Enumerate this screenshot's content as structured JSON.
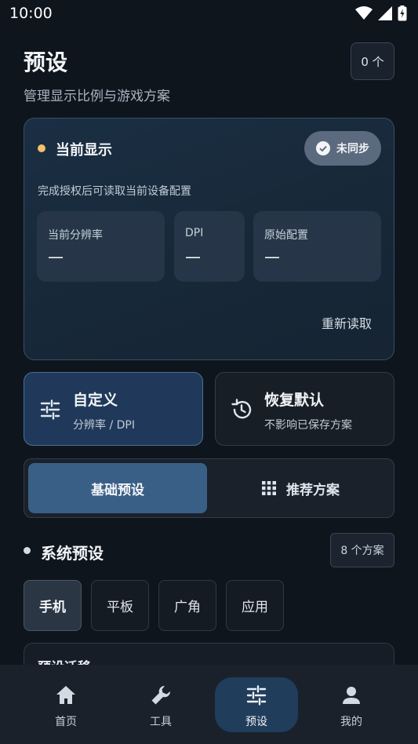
{
  "status_bar": {
    "time": "10:00"
  },
  "header": {
    "title": "预设",
    "subtitle": "管理显示比例与游戏方案",
    "count_badge": "0 个"
  },
  "display_card": {
    "title": "当前显示",
    "sync_status": "未同步",
    "description": "完成授权后可读取当前设备配置",
    "stats": [
      {
        "label": "当前分辨率",
        "value": "—"
      },
      {
        "label": "DPI",
        "value": "—"
      },
      {
        "label": "原始配置",
        "value": "—"
      }
    ],
    "reload_label": "重新读取"
  },
  "actions": {
    "custom": {
      "title": "自定义",
      "subtitle": "分辨率 / DPI"
    },
    "reset": {
      "title": "恢复默认",
      "subtitle": "不影响已保存方案"
    }
  },
  "segments": {
    "active": "基础预设",
    "other": "推荐方案"
  },
  "section": {
    "title": "系统预设",
    "count": "8 个方案"
  },
  "filters": [
    "手机",
    "平板",
    "广角",
    "应用"
  ],
  "list_card": {
    "title": "预设迁移"
  },
  "nav": [
    "首页",
    "工具",
    "预设",
    "我的"
  ],
  "colors": {
    "accent": "#3a5f86",
    "warning_dot": "#f4c06a",
    "background": "#0f151d"
  }
}
